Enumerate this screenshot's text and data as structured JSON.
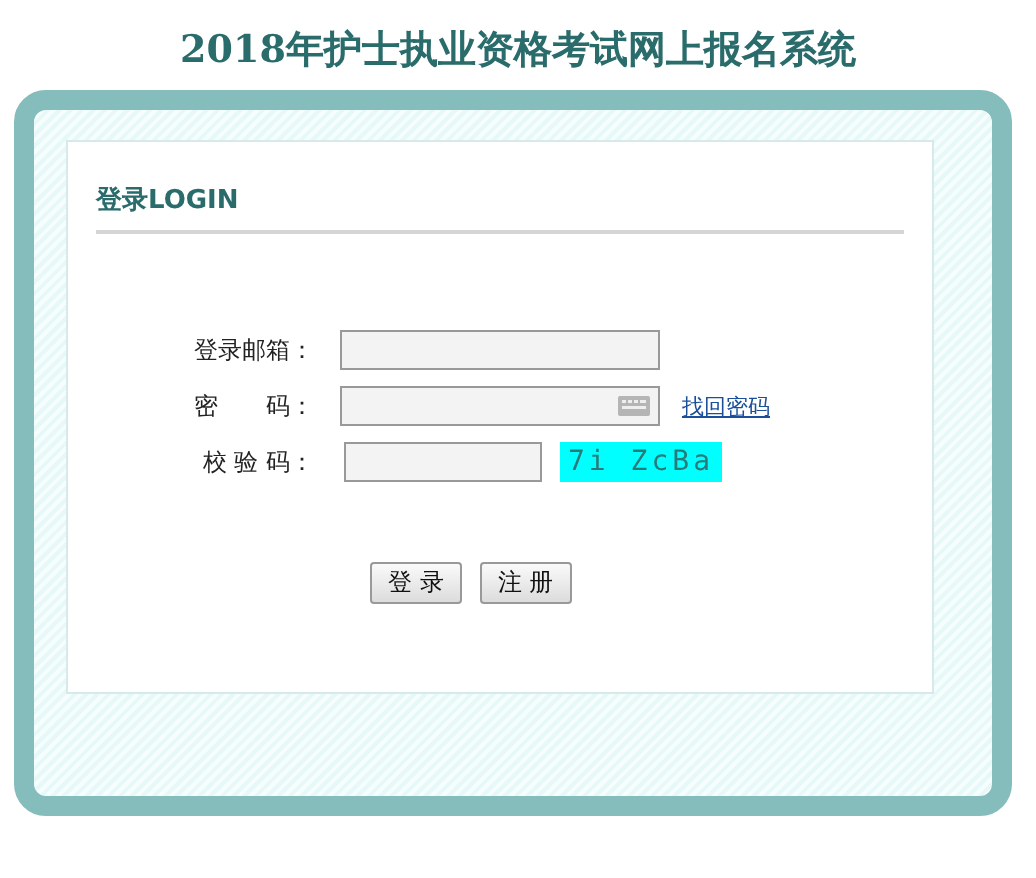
{
  "title": "2018年护士执业资格考试网上报名系统",
  "login": {
    "heading": "登录LOGIN",
    "fields": [
      {
        "kind": "text",
        "label": "登录邮箱："
      },
      {
        "kind": "password",
        "label": "密　　码：",
        "link": "找回密码"
      },
      {
        "kind": "captcha",
        "label": "校 验 码：",
        "captcha": "7i ZcBa"
      }
    ],
    "buttons": [
      "登 录",
      "注 册"
    ]
  }
}
